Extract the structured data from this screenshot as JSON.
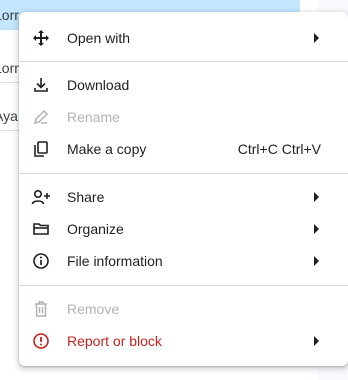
{
  "background": {
    "rows": [
      "Lorr",
      "Lorr",
      "Aya"
    ]
  },
  "menu": {
    "items": [
      {
        "label": "Open with",
        "icon": "move-icon",
        "submenu": true
      },
      {
        "label": "Download",
        "icon": "download-icon"
      },
      {
        "label": "Rename",
        "icon": "pencil-icon",
        "disabled": true
      },
      {
        "label": "Make a copy",
        "icon": "copy-icon",
        "shortcut": "Ctrl+C Ctrl+V"
      },
      {
        "label": "Share",
        "icon": "person-add-icon",
        "submenu": true
      },
      {
        "label": "Organize",
        "icon": "folder-icon",
        "submenu": true
      },
      {
        "label": "File information",
        "icon": "info-icon",
        "submenu": true
      },
      {
        "label": "Remove",
        "icon": "trash-icon",
        "disabled": true
      },
      {
        "label": "Report or block",
        "icon": "report-icon",
        "submenu": true
      }
    ]
  },
  "colors": {
    "accent": "#c2e7ff",
    "danger": "#c5221f",
    "disabled": "#b3b3b3"
  }
}
